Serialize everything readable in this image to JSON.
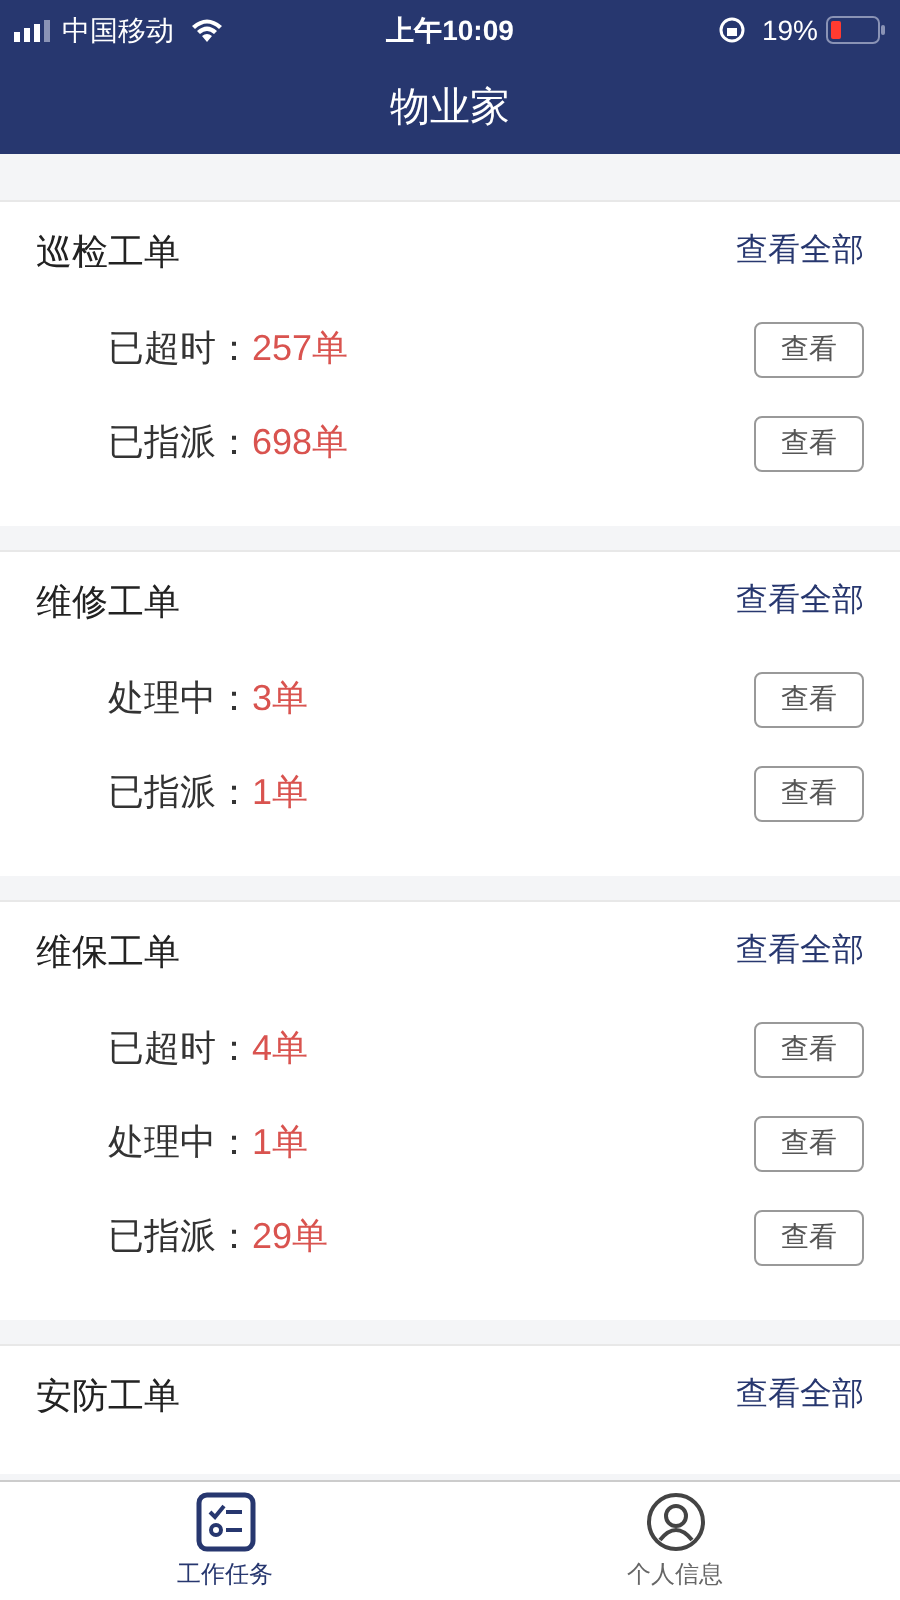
{
  "status_bar": {
    "carrier": "中国移动",
    "time": "上午10:09",
    "battery": "19%"
  },
  "header": {
    "title": "物业家"
  },
  "sections": [
    {
      "title": "巡检工单",
      "link": "查看全部",
      "rows": [
        {
          "label": "已超时：",
          "count": "257单",
          "button": "查看"
        },
        {
          "label": "已指派：",
          "count": "698单",
          "button": "查看"
        }
      ]
    },
    {
      "title": "维修工单",
      "link": "查看全部",
      "rows": [
        {
          "label": "处理中：",
          "count": "3单",
          "button": "查看"
        },
        {
          "label": "已指派：",
          "count": "1单",
          "button": "查看"
        }
      ]
    },
    {
      "title": "维保工单",
      "link": "查看全部",
      "rows": [
        {
          "label": "已超时：",
          "count": "4单",
          "button": "查看"
        },
        {
          "label": "处理中：",
          "count": "1单",
          "button": "查看"
        },
        {
          "label": "已指派：",
          "count": "29单",
          "button": "查看"
        }
      ]
    },
    {
      "title": "安防工单",
      "link": "查看全部"
    }
  ],
  "tab_bar": [
    {
      "label": "工作任务",
      "kind": "tasks",
      "selected": true
    },
    {
      "label": "个人信息",
      "kind": "profile",
      "selected": false
    }
  ]
}
